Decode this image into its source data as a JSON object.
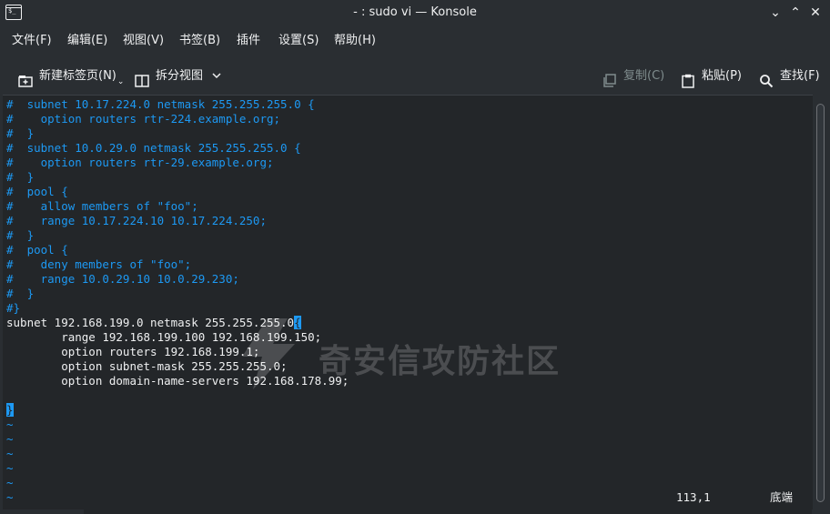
{
  "window": {
    "title": "- : sudo vi — Konsole",
    "app_icon_glyph": "$_",
    "controls": {
      "minimize": "⌄",
      "maximize": "⌃",
      "close": "✕"
    }
  },
  "menubar": {
    "items": [
      "文件(F)",
      "编辑(E)",
      "视图(V)",
      "书签(B)",
      "插件",
      "设置(S)",
      "帮助(H)"
    ]
  },
  "toolbar": {
    "new_tab": "新建标签页(N)",
    "split_view": "拆分视图",
    "copy": "复制(C)",
    "paste": "粘贴(P)",
    "find": "查找(F)"
  },
  "icons": {
    "new_tab": "new-tab-icon",
    "split_view": "split-view-icon",
    "copy": "copy-icon",
    "paste": "paste-icon",
    "find": "search-icon"
  },
  "terminal": {
    "lines": [
      {
        "text": "#  subnet 10.17.224.0 netmask 255.255.255.0 {",
        "style": "comment"
      },
      {
        "text": "#    option routers rtr-224.example.org;",
        "style": "comment"
      },
      {
        "text": "#  }",
        "style": "comment"
      },
      {
        "text": "#  subnet 10.0.29.0 netmask 255.255.255.0 {",
        "style": "comment"
      },
      {
        "text": "#    option routers rtr-29.example.org;",
        "style": "comment"
      },
      {
        "text": "#  }",
        "style": "comment"
      },
      {
        "text": "#  pool {",
        "style": "comment"
      },
      {
        "text": "#    allow members of \"foo\";",
        "style": "comment"
      },
      {
        "text": "#    range 10.17.224.10 10.17.224.250;",
        "style": "comment"
      },
      {
        "text": "#  }",
        "style": "comment"
      },
      {
        "text": "#  pool {",
        "style": "comment"
      },
      {
        "text": "#    deny members of \"foo\";",
        "style": "comment"
      },
      {
        "text": "#    range 10.0.29.10 10.0.29.230;",
        "style": "comment"
      },
      {
        "text": "#  }",
        "style": "comment"
      },
      {
        "text": "#}",
        "style": "comment"
      },
      {
        "text": "subnet 192.168.199.0 netmask 255.255.255.0",
        "style": "normal",
        "highlight_suffix": "{"
      },
      {
        "text": "        range 192.168.199.100 192.168.199.150;",
        "style": "normal"
      },
      {
        "text": "        option routers 192.168.199.1;",
        "style": "normal"
      },
      {
        "text": "        option subnet-mask 255.255.255.0;",
        "style": "normal"
      },
      {
        "text": "        option domain-name-servers 192.168.178.99;",
        "style": "normal"
      },
      {
        "text": "",
        "style": "normal"
      },
      {
        "text": "",
        "style": "cursor",
        "highlight_suffix": "}"
      },
      {
        "text": "~",
        "style": "tilde"
      },
      {
        "text": "~",
        "style": "tilde"
      },
      {
        "text": "~",
        "style": "tilde"
      },
      {
        "text": "~",
        "style": "tilde"
      },
      {
        "text": "~",
        "style": "tilde"
      },
      {
        "text": "~",
        "style": "tilde"
      }
    ],
    "status_position": "113,1",
    "status_scroll": "底端"
  },
  "watermark": {
    "text": "奇安信攻防社区"
  },
  "colors": {
    "background": "#232629",
    "window": "#2a2e32",
    "text": "#eff0f1",
    "accent": "#1d99f3",
    "disabled": "#7f8c8d"
  }
}
